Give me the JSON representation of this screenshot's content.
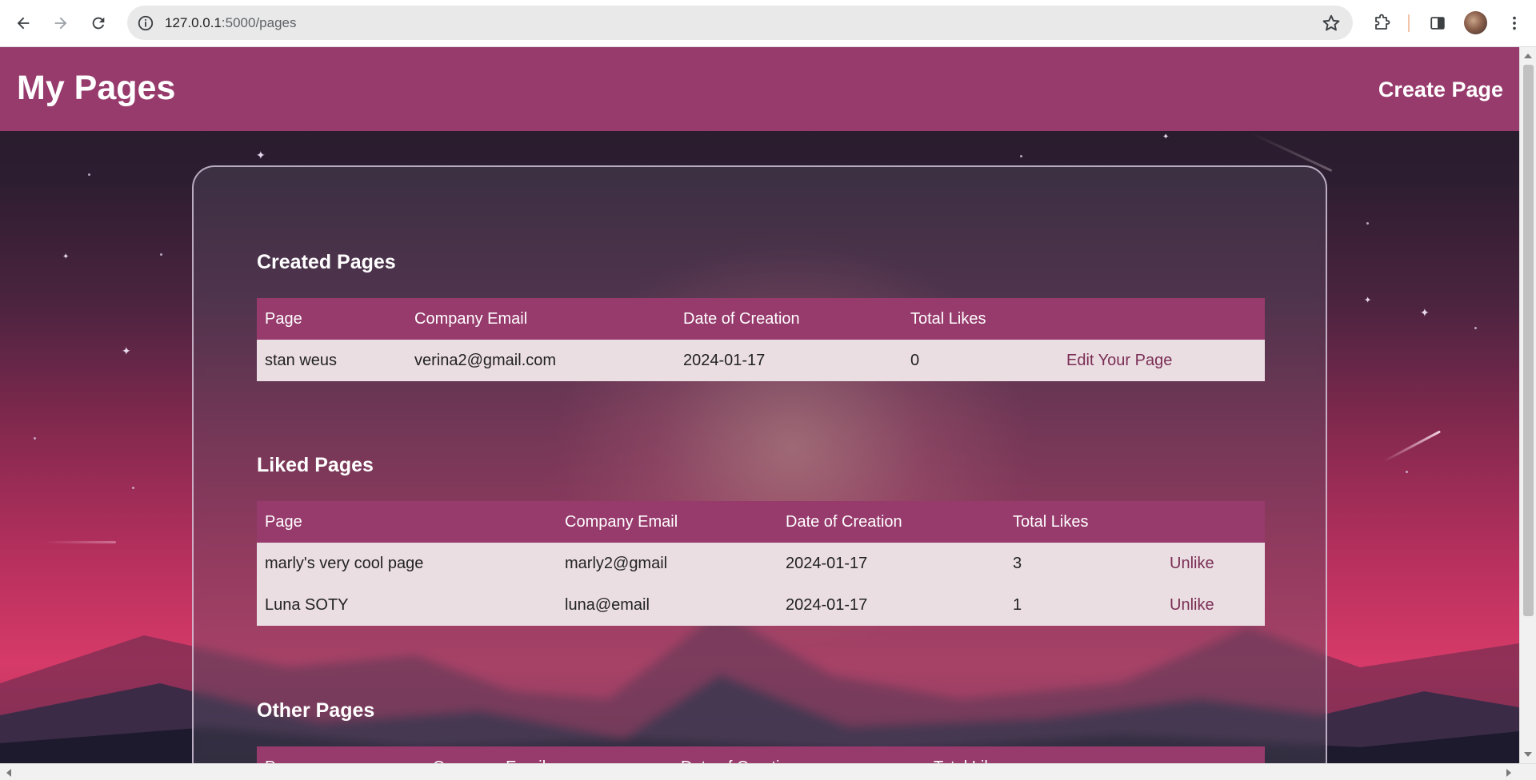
{
  "browser": {
    "url_host": "127.0.0.1",
    "url_path": ":5000/pages"
  },
  "header": {
    "title": "My Pages",
    "create_link": "Create Page"
  },
  "created_pages": {
    "title": "Created Pages",
    "columns": [
      "Page",
      "Company Email",
      "Date of Creation",
      "Total Likes",
      ""
    ],
    "rows": [
      {
        "page": "stan weus",
        "email": "verina2@gmail.com",
        "date": "2024-01-17",
        "likes": "0",
        "action": "Edit Your Page"
      }
    ]
  },
  "liked_pages": {
    "title": "Liked Pages",
    "columns": [
      "Page",
      "Company Email",
      "Date of Creation",
      "Total Likes",
      ""
    ],
    "rows": [
      {
        "page": "marly's very cool page",
        "email": "marly2@gmail",
        "date": "2024-01-17",
        "likes": "3",
        "action": "Unlike"
      },
      {
        "page": "Luna SOTY",
        "email": "luna@email",
        "date": "2024-01-17",
        "likes": "1",
        "action": "Unlike"
      }
    ]
  },
  "other_pages": {
    "title": "Other Pages",
    "columns": [
      "Page",
      "Company Email",
      "Date of Creation",
      "Total Likes",
      ""
    ]
  },
  "colors": {
    "header_bg": "#973a6c",
    "row_bg": "#ebdee3",
    "action_text": "#7a2e54"
  },
  "icons": [
    "back-icon",
    "forward-icon",
    "reload-icon",
    "info-icon",
    "star-icon",
    "extensions-icon",
    "side-panel-icon",
    "more-icon"
  ]
}
